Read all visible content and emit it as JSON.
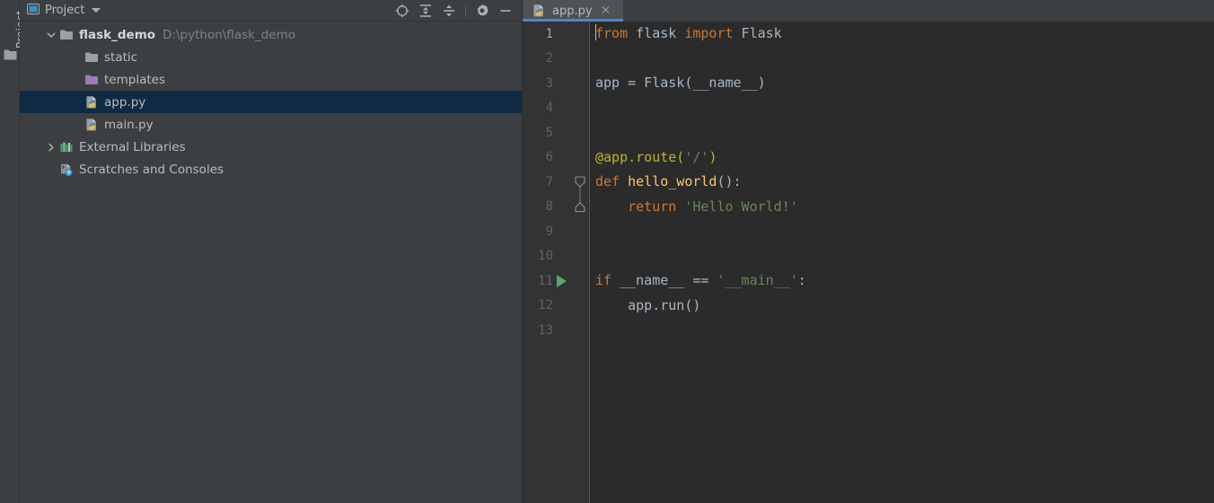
{
  "toolstrip": {
    "label": "Project",
    "folder_icon": "folder-icon"
  },
  "project_panel": {
    "header": {
      "icon": "project-view-icon",
      "title": "Project",
      "dropdown_icon": "chevron-down-icon",
      "toolbar": [
        {
          "name": "select-opened-file-icon",
          "title": "Select Opened File"
        },
        {
          "name": "expand-all-icon",
          "title": "Expand All"
        },
        {
          "name": "collapse-all-icon",
          "title": "Collapse All"
        },
        {
          "name": "settings-gear-icon",
          "title": "Settings"
        },
        {
          "name": "hide-panel-icon",
          "title": "Hide"
        }
      ]
    },
    "tree": [
      {
        "label": "flask_demo",
        "path": "D:\\python\\flask_demo",
        "icon": "folder-icon",
        "twisty": "expanded",
        "depth": 0,
        "bold": true,
        "selected": false
      },
      {
        "label": "static",
        "path": "",
        "icon": "folder-icon",
        "twisty": "none",
        "depth": 1,
        "bold": false,
        "selected": false
      },
      {
        "label": "templates",
        "path": "",
        "icon": "folder-templates-icon",
        "twisty": "none",
        "depth": 1,
        "bold": false,
        "selected": false
      },
      {
        "label": "app.py",
        "path": "",
        "icon": "python-file-icon",
        "twisty": "none",
        "depth": 1,
        "bold": false,
        "selected": true
      },
      {
        "label": "main.py",
        "path": "",
        "icon": "python-file-icon",
        "twisty": "none",
        "depth": 1,
        "bold": false,
        "selected": false
      },
      {
        "label": "External Libraries",
        "path": "",
        "icon": "external-libraries-icon",
        "twisty": "collapsed",
        "depth": 0,
        "bold": false,
        "selected": false
      },
      {
        "label": "Scratches and Consoles",
        "path": "",
        "icon": "scratches-icon",
        "twisty": "none",
        "depth": 0,
        "bold": false,
        "selected": false
      }
    ]
  },
  "editor": {
    "tabs": [
      {
        "label": "app.py",
        "icon": "python-file-icon",
        "close_icon": "close-icon",
        "active": true
      }
    ],
    "line_numbers": [
      "1",
      "2",
      "3",
      "4",
      "5",
      "6",
      "7",
      "8",
      "9",
      "10",
      "11",
      "12",
      "13"
    ],
    "current_line": 1,
    "run_marker_line": 11,
    "fold_start_line": 7,
    "fold_end_line": 8,
    "lines": [
      {
        "n": 1,
        "caret": true,
        "tokens": [
          {
            "t": "from",
            "c": "tok-kw"
          },
          {
            "t": " flask ",
            "c": "tok-id"
          },
          {
            "t": "import",
            "c": "tok-kw"
          },
          {
            "t": " Flask",
            "c": "tok-id"
          }
        ]
      },
      {
        "n": 2,
        "caret": false,
        "tokens": []
      },
      {
        "n": 3,
        "caret": false,
        "tokens": [
          {
            "t": "app = Flask(__name__)",
            "c": "tok-id"
          }
        ]
      },
      {
        "n": 4,
        "caret": false,
        "tokens": []
      },
      {
        "n": 5,
        "caret": false,
        "tokens": []
      },
      {
        "n": 6,
        "caret": false,
        "tokens": [
          {
            "t": "@app.route(",
            "c": "tok-dec"
          },
          {
            "t": "'/'",
            "c": "tok-str"
          },
          {
            "t": ")",
            "c": "tok-dec"
          }
        ]
      },
      {
        "n": 7,
        "caret": false,
        "tokens": [
          {
            "t": "def ",
            "c": "tok-def"
          },
          {
            "t": "hello_world",
            "c": "tok-fn"
          },
          {
            "t": "():",
            "c": "tok-id"
          }
        ]
      },
      {
        "n": 8,
        "caret": false,
        "tokens": [
          {
            "t": "    ",
            "c": "tok-id"
          },
          {
            "t": "return",
            "c": "tok-kw"
          },
          {
            "t": " ",
            "c": "tok-id"
          },
          {
            "t": "'Hello World!'",
            "c": "tok-str"
          }
        ]
      },
      {
        "n": 9,
        "caret": false,
        "tokens": []
      },
      {
        "n": 10,
        "caret": false,
        "tokens": []
      },
      {
        "n": 11,
        "caret": false,
        "tokens": [
          {
            "t": "if",
            "c": "tok-kw"
          },
          {
            "t": " __name__ == ",
            "c": "tok-id"
          },
          {
            "t": "'__main__'",
            "c": "tok-str"
          },
          {
            "t": ":",
            "c": "tok-id"
          }
        ]
      },
      {
        "n": 12,
        "caret": false,
        "tokens": [
          {
            "t": "    app.run()",
            "c": "tok-id"
          }
        ]
      },
      {
        "n": 13,
        "caret": false,
        "tokens": []
      }
    ]
  },
  "colors": {
    "panel_bg": "#3c3f41",
    "editor_bg": "#2b2b2b",
    "gutter_bg": "#313335",
    "selection_bg": "#0f2b44",
    "tab_active_bg": "#4e5254",
    "tab_underline": "#4a88c7",
    "keyword": "#cc7832",
    "identifier": "#a9b7c6",
    "string": "#6a8759",
    "function": "#ffc66d",
    "decorator": "#bbb529",
    "run_green": "#59a869"
  }
}
